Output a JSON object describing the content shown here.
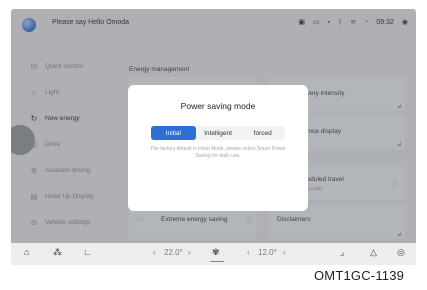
{
  "status": {
    "greeting": "Please say Hello Omoda",
    "clock": "09:32"
  },
  "sidebar": {
    "items": [
      {
        "label": "Quick control",
        "icon": "quick-control-icon",
        "active": false
      },
      {
        "label": "Light",
        "icon": "light-icon",
        "active": false
      },
      {
        "label": "New energy",
        "icon": "new-energy-icon",
        "active": true
      },
      {
        "label": "Drive",
        "icon": "drive-icon",
        "active": false
      },
      {
        "label": "Assisted driving",
        "icon": "assisted-driving-icon",
        "active": false
      },
      {
        "label": "Head Up Display",
        "icon": "head-up-display-icon",
        "active": false
      },
      {
        "label": "Vehicle settings",
        "icon": "vehicle-settings-icon",
        "active": false
      }
    ]
  },
  "main": {
    "section_title": "Energy management",
    "cards": {
      "recovery": "overy intensity",
      "distance": "tance display",
      "scheduled": "heduled travel",
      "scheduled_sub": "d formally",
      "extreme": "Extreme energy saving",
      "disclaimers": "Disclaimers"
    }
  },
  "dialog": {
    "title": "Power saving mode",
    "options": [
      "Initial",
      "Intelligent",
      "forced"
    ],
    "selected": "Initial",
    "description": "The factory default is Initial Mode, please select Smart Power Saving for daily use."
  },
  "dock": {
    "temp_left": "22.0°",
    "temp_right": "12.0°"
  },
  "caption": "OMT1GC-1139",
  "colors": {
    "accent": "#2d6fd6",
    "screen_bg": "#e6e8eb"
  }
}
